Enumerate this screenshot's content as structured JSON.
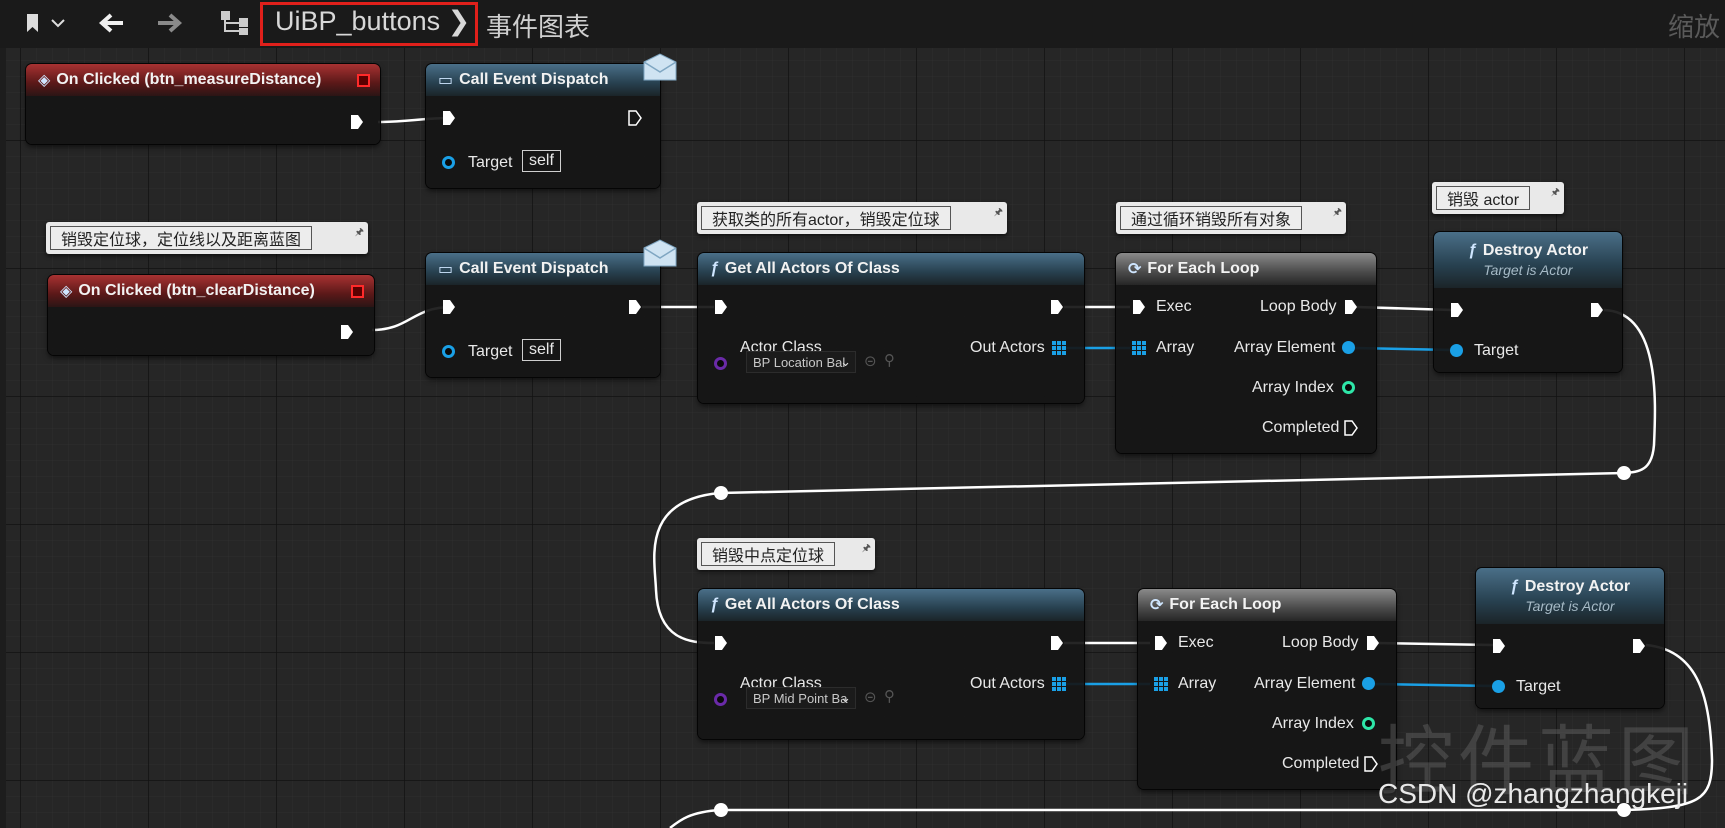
{
  "toolbar": {
    "bookmark_icon": "bookmark-icon",
    "back_icon": "arrow-left-icon",
    "forward_icon": "arrow-right-icon",
    "graph_icon": "hierarchy-icon",
    "breadcrumb": "UiBP_buttons",
    "breadcrumb_sep": "❯",
    "graph_name": "事件图表",
    "zoom_label": "缩放"
  },
  "comments": {
    "c1": "销毁定位球，定位线以及距离蓝图",
    "c2": "获取类的所有actor，销毁定位球",
    "c3": "通过循环销毁所有对象",
    "c4": "销毁 actor",
    "c5": "销毁中点定位球"
  },
  "nodes": {
    "onclick1": {
      "title": "On Clicked (btn_measureDistance)"
    },
    "onclick2": {
      "title": "On Clicked (btn_clearDistance)"
    },
    "dispatch1": {
      "title": "Call Event Dispatch",
      "target": "Target",
      "self": "self"
    },
    "dispatch2": {
      "title": "Call Event Dispatch",
      "target": "Target",
      "self": "self"
    },
    "getall1": {
      "title": "Get All Actors Of Class",
      "actor_class": "Actor Class",
      "out_actors": "Out Actors",
      "class_value": "BP Location Bal"
    },
    "getall2": {
      "title": "Get All Actors Of Class",
      "actor_class": "Actor Class",
      "out_actors": "Out Actors",
      "class_value": "BP Mid Point Ba"
    },
    "loop1": {
      "title": "For Each Loop",
      "exec": "Exec",
      "array": "Array",
      "loop_body": "Loop Body",
      "array_element": "Array Element",
      "array_index": "Array Index",
      "completed": "Completed"
    },
    "loop2": {
      "title": "For Each Loop",
      "exec": "Exec",
      "array": "Array",
      "loop_body": "Loop Body",
      "array_element": "Array Element",
      "array_index": "Array Index",
      "completed": "Completed"
    },
    "destroy1": {
      "title": "Destroy Actor",
      "subtitle": "Target is Actor",
      "target": "Target"
    },
    "destroy2": {
      "title": "Destroy Actor",
      "subtitle": "Target is Actor",
      "target": "Target"
    }
  },
  "watermark": {
    "big": "控件蓝图",
    "credit": "CSDN @zhangzhangkeji"
  },
  "colors": {
    "event_header": "#a83232",
    "function_header": "#4a6f88",
    "macro_header": "#8a8a8a",
    "object_pin": "#1aa0e6",
    "class_pin": "#6a2aa8",
    "int_pin": "#2ee6a8",
    "highlight_box": "#e0201b"
  }
}
